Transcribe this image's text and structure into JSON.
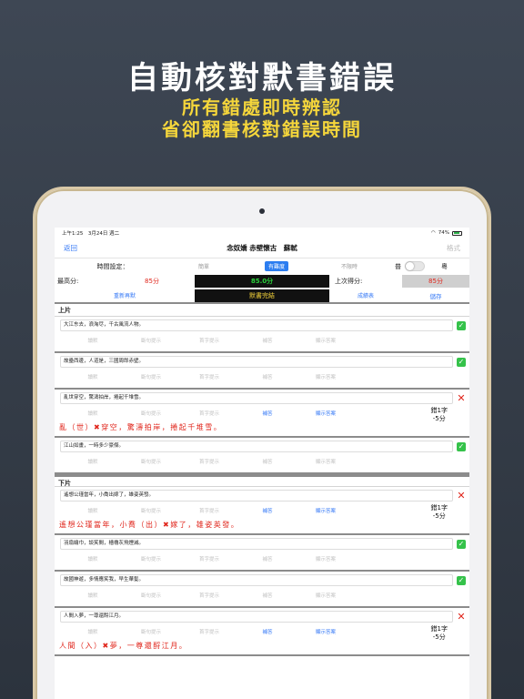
{
  "promo": {
    "headline": "自動核對默書錯誤",
    "sub1": "所有錯處即時辨認",
    "sub2": "省卻翻書核對錯誤時間"
  },
  "status": {
    "time": "上午1:25　3月24日 週二",
    "battery": "74%"
  },
  "nav": {
    "back": "返回",
    "title": "念奴嬌 赤壁懷古　蘇軾",
    "format": "格式"
  },
  "timer": {
    "label": "時間設定：",
    "modes": [
      "簡單",
      "有難度",
      "不限時"
    ],
    "lang_a": "普",
    "lang_b": "粵"
  },
  "scores": {
    "best_label": "最高分:",
    "best": "85分",
    "current": "85.0分",
    "last_label": "上次得分:",
    "last": "85分"
  },
  "actions": {
    "restart": "重新再默",
    "done": "默書完結",
    "report": "成績表",
    "save": "儲存"
  },
  "sections": [
    {
      "title": "上片",
      "items": [
        {
          "text": "大江东去，浪淘尽，千古風流人物。",
          "status": "ok"
        },
        {
          "text": "故壘西邊，人道是，三國周郎赤壁。",
          "status": "ok"
        },
        {
          "text": "亂世穿空，驚濤拍岸，捲起千堆雪。",
          "status": "wrong",
          "err": "錯1字",
          "penalty": "-5分",
          "answer_pre": "亂（世）",
          "answer_post": "穿空，驚濤拍岸，捲起千堆雪。"
        },
        {
          "text": "江山如畫，一時多少豪傑。",
          "status": "ok"
        }
      ]
    },
    {
      "title": "下片",
      "items": [
        {
          "text": "遙想公瑾當年，小喬出嫁了，雄姿英發。",
          "status": "wrong",
          "err": "錯1字",
          "penalty": "-5分",
          "answer_pre": "遙想公瑾當年，小喬（出）",
          "answer_post": "嫁了，雄姿英發。"
        },
        {
          "text": "羽扇綸巾，談笑間，檣櫓灰飛煙滅。",
          "status": "ok"
        },
        {
          "text": "故國神遊，多情應笑我，早生華髮。",
          "status": "ok"
        },
        {
          "text": "人間入夢，一尊還酹江月。",
          "status": "wrong",
          "err": "錯1字",
          "penalty": "-5分",
          "answer_pre": "人間（入）",
          "answer_post": "夢，一尊還酹江月。"
        }
      ]
    }
  ],
  "buttons": [
    "讀默",
    "斷句提示",
    "首字提示",
    "補答",
    "顯示答案"
  ]
}
